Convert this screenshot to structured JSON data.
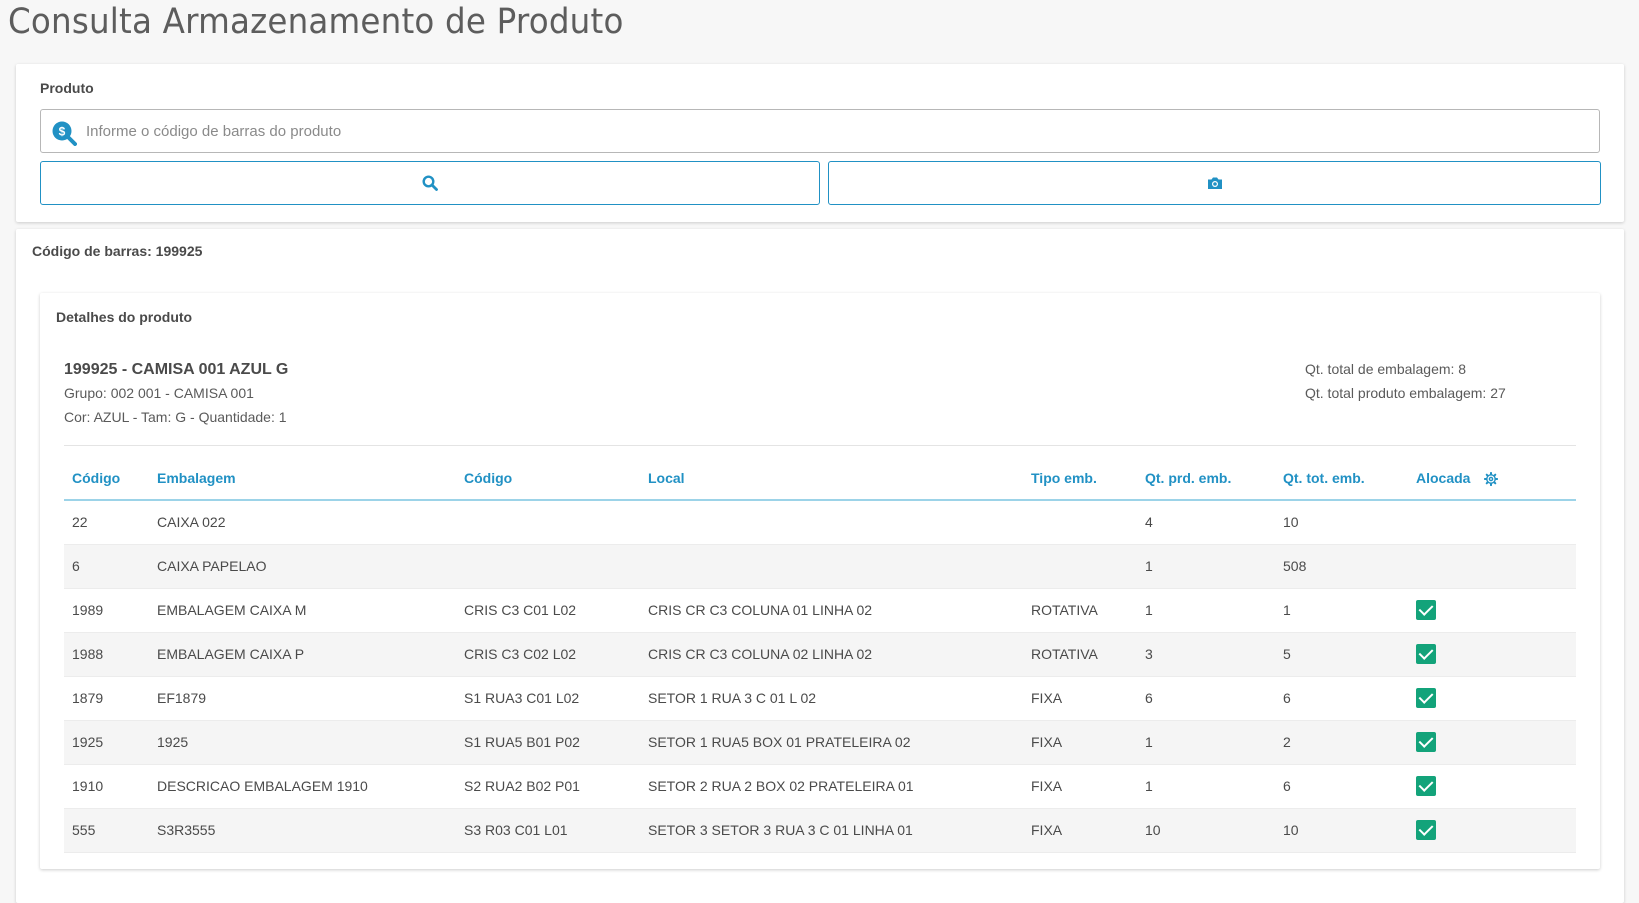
{
  "page": {
    "title": "Consulta Armazenamento de Produto"
  },
  "search": {
    "label": "Produto",
    "placeholder": "Informe o código de barras do produto",
    "value": ""
  },
  "result": {
    "barcode_label": "Código de barras: 199925",
    "details_title": "Detalhes do produto",
    "product_name": "199925 - CAMISA 001 AZUL G",
    "group": "Grupo: 002 001 - CAMISA 001",
    "attributes": "Cor: AZUL - Tam: G - Quantidade: 1",
    "qt_total_embalagem": "Qt. total de embalagem: 8",
    "qt_total_produto_embalagem": "Qt. total produto embalagem: 27"
  },
  "table": {
    "headers": [
      "Código",
      "Embalagem",
      "Código",
      "Local",
      "Tipo emb.",
      "Qt. prd. emb.",
      "Qt. tot. emb.",
      "Alocada"
    ],
    "rows": [
      {
        "codigo": "22",
        "embalagem": "CAIXA 022",
        "codigo_local": "",
        "local": "",
        "tipo": "",
        "qt_prd": "4",
        "qt_tot": "10",
        "alocada": false
      },
      {
        "codigo": "6",
        "embalagem": "CAIXA PAPELAO",
        "codigo_local": "",
        "local": "",
        "tipo": "",
        "qt_prd": "1",
        "qt_tot": "508",
        "alocada": false
      },
      {
        "codigo": "1989",
        "embalagem": "EMBALAGEM CAIXA M",
        "codigo_local": "CRIS C3 C01 L02",
        "local": "CRIS CR C3 COLUNA 01 LINHA 02",
        "tipo": "ROTATIVA",
        "qt_prd": "1",
        "qt_tot": "1",
        "alocada": true
      },
      {
        "codigo": "1988",
        "embalagem": "EMBALAGEM CAIXA P",
        "codigo_local": "CRIS C3 C02 L02",
        "local": "CRIS CR C3 COLUNA 02 LINHA 02",
        "tipo": "ROTATIVA",
        "qt_prd": "3",
        "qt_tot": "5",
        "alocada": true
      },
      {
        "codigo": "1879",
        "embalagem": "EF1879",
        "codigo_local": "S1 RUA3 C01 L02",
        "local": "SETOR 1 RUA 3 C 01 L 02",
        "tipo": "FIXA",
        "qt_prd": "6",
        "qt_tot": "6",
        "alocada": true
      },
      {
        "codigo": "1925",
        "embalagem": "1925",
        "codigo_local": "S1 RUA5 B01 P02",
        "local": "SETOR 1 RUA5 BOX 01 PRATELEIRA 02",
        "tipo": "FIXA",
        "qt_prd": "1",
        "qt_tot": "2",
        "alocada": true
      },
      {
        "codigo": "1910",
        "embalagem": "DESCRICAO EMBALAGEM 1910",
        "codigo_local": "S2 RUA2 B02 P01",
        "local": "SETOR 2 RUA 2 BOX 02 PRATELEIRA 01",
        "tipo": "FIXA",
        "qt_prd": "1",
        "qt_tot": "6",
        "alocada": true
      },
      {
        "codigo": "555",
        "embalagem": "S3R3555",
        "codigo_local": "S3 R03 C01 L01",
        "local": "SETOR 3 SETOR 3 RUA 3 C 01 LINHA 01",
        "tipo": "FIXA",
        "qt_prd": "10",
        "qt_tot": "10",
        "alocada": true
      }
    ]
  },
  "icons": {
    "search_field": "product-search-icon",
    "search_button": "search-icon",
    "camera_button": "camera-icon",
    "settings": "gear-icon",
    "checkbox": "checkbox-checked-icon"
  },
  "colors": {
    "accent": "#2191c4",
    "check": "#13a37a",
    "title": "#5d5d5d"
  }
}
